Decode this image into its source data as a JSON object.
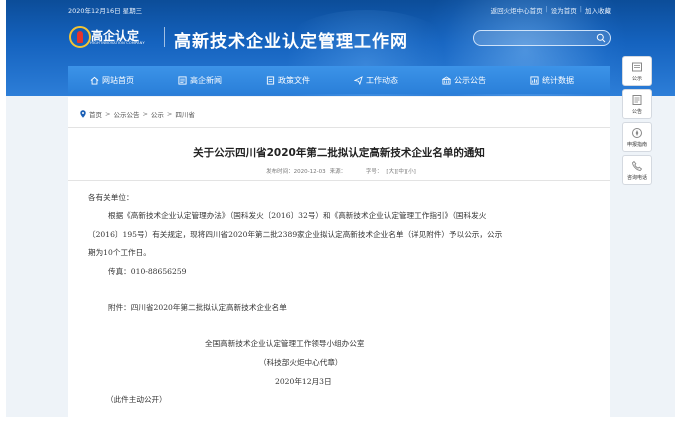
{
  "topbar": {
    "date": "2020年12月16日 星期三",
    "links": [
      "返回火炬中心首页",
      "设为首页",
      "加入收藏"
    ]
  },
  "logo": {
    "brand": "高企认定",
    "brand_en": "HIGH INNOVATION COMPANY"
  },
  "site_title": "高新技术企业认定管理工作网",
  "search": {
    "placeholder": ""
  },
  "nav": {
    "items": [
      {
        "label": "网站首页",
        "icon": "home-icon"
      },
      {
        "label": "高企新闻",
        "icon": "news-icon"
      },
      {
        "label": "政策文件",
        "icon": "document-icon"
      },
      {
        "label": "工作动态",
        "icon": "send-icon"
      },
      {
        "label": "公示公告",
        "icon": "bank-icon"
      },
      {
        "label": "统计数据",
        "icon": "chart-icon"
      }
    ]
  },
  "breadcrumb": [
    "首页",
    "公示公告",
    "公示",
    "四川省"
  ],
  "article": {
    "title": "关于公示四川省2020年第二批拟认定高新技术企业名单的通知",
    "meta": {
      "date": "发布时间：2020-12-03",
      "source": "来源：",
      "font_label": "字号：",
      "font_sizes": [
        "[大]",
        "[中]",
        "[小]"
      ]
    },
    "lines": [
      "各有关单位：",
      "根据《高新技术企业认定管理办法》（国科发火〔2016〕32号）和《高新技术企业认定管理工作指引》（国科发火",
      "〔2016〕195号）有关规定，现将四川省2020年第二批2389家企业拟认定高新技术企业名单（详见附件）予以公示，公示",
      "期为10个工作日。",
      "传真：010-88656259",
      "附件：四川省2020年第二批拟认定高新技术企业名单",
      "全国高新技术企业认定管理工作领导小组办公室",
      "（科技部火炬中心代章）",
      "2020年12月3日",
      "（此件主动公开）"
    ]
  },
  "side": {
    "buttons": [
      {
        "label": "公示",
        "icon": "notice-icon"
      },
      {
        "label": "公告",
        "icon": "announcement-icon"
      },
      {
        "label": "申报指南",
        "icon": "guide-icon"
      },
      {
        "label": "咨询电话",
        "icon": "phone-icon"
      }
    ]
  },
  "colors": {
    "header_blue": "#1563bf",
    "nav_blue": "#2a7fd9",
    "accent_red": "#e5342b",
    "logo_gold": "#f3c433"
  }
}
